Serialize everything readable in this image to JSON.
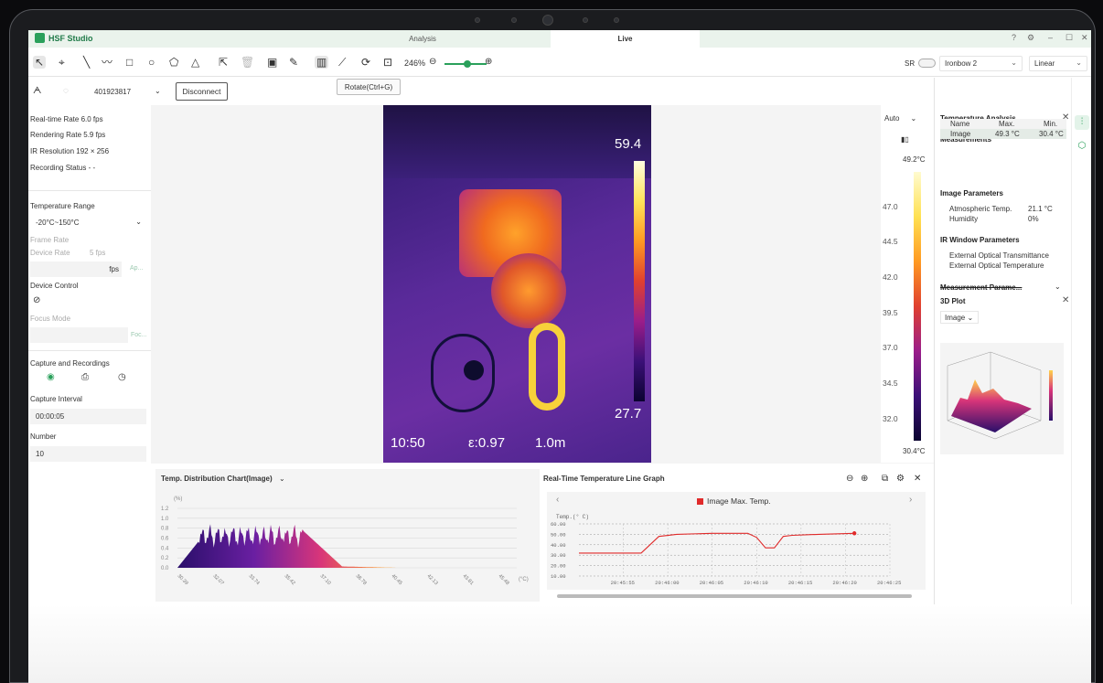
{
  "window": {
    "app_name": "HSF Studio",
    "tabs": [
      {
        "label": "Analysis"
      },
      {
        "label": "Live"
      }
    ],
    "controls": [
      "?",
      "⚙",
      "–",
      "☐",
      "✕"
    ]
  },
  "toolbar": {
    "zoom": "246%",
    "tooltip": "Rotate(Ctrl+G)",
    "sr_label": "SR",
    "palette": "Ironbow 2",
    "scale_mode": "Linear"
  },
  "device": {
    "id": "401923817",
    "disconnect_label": "Disconnect"
  },
  "status": {
    "realtime_rate": "Real-time Rate  6.0 fps",
    "rendering_rate": "Rendering Rate  5.9 fps",
    "ir_resolution": "IR Resolution  192 × 256",
    "recording_status": "Recording Status  - -"
  },
  "left_panel": {
    "temp_range_label": "Temperature Range",
    "temp_range_value": "-20°C~150°C",
    "frame_rate_label": "Frame Rate",
    "device_rate_label": "Device Rate",
    "device_rate_value": "5 fps",
    "fps_label": "fps",
    "apply_label": "Ap...",
    "device_control_label": "Device Control",
    "focus_mode_label": "Focus Mode",
    "focus_btn": "Foc...",
    "capture_label": "Capture and Recordings",
    "capture_interval_label": "Capture Interval",
    "capture_interval_value": "00:00:05",
    "number_label": "Number",
    "number_value": "10"
  },
  "image": {
    "max": "59.4",
    "min": "27.7",
    "time": "10:50",
    "emissivity": "ε:0.97",
    "distance": "1.0m"
  },
  "scale": {
    "mode": "Auto",
    "top": "49.2°C",
    "bottom": "30.4°C",
    "ticks": [
      "47.0",
      "44.5",
      "42.0",
      "39.5",
      "37.0",
      "34.5",
      "32.0"
    ]
  },
  "analysis": {
    "title": "Temperature Analysis",
    "measurements_title": "Measurements",
    "col_name": "Name",
    "col_max": "Max.",
    "col_min": "Min.",
    "row_name": "Image",
    "row_max": "49.3 °C",
    "row_min": "30.4 °C",
    "image_params_title": "Image Parameters",
    "atm_label": "Atmospheric Temp.",
    "atm_value": "21.1 °C",
    "hum_label": "Humidity",
    "hum_value": "0%",
    "ir_window_title": "IR Window Parameters",
    "ext_trans": "External Optical Transmittance",
    "ext_temp": "External Optical Temperature",
    "meas_params_title": "Measurement Parame...",
    "plot3d_title": "3D Plot",
    "plot3d_source": "Image"
  },
  "histogram": {
    "title": "Temp. Distribution Chart(Image)",
    "y_unit": "(%)",
    "y_ticks": [
      "1.2",
      "1.0",
      "0.8",
      "0.6",
      "0.4",
      "0.2",
      "0.0"
    ],
    "x_ticks": [
      "30.39",
      "32.07",
      "33.74",
      "35.42",
      "37.10",
      "38.78",
      "40.45",
      "42.13",
      "43.81",
      "45.48"
    ],
    "x_unit": "(°C)"
  },
  "chart_data": {
    "type": "line",
    "title": "Real-Time Temperature Line Graph",
    "ylabel": "Temp.(° C)",
    "ylim": [
      10,
      60
    ],
    "y_ticks": [
      "60.00",
      "50.00",
      "40.00",
      "30.00",
      "20.00",
      "10.00"
    ],
    "x_ticks": [
      "20:45:55",
      "20:46:00",
      "20:46:05",
      "20:46:10",
      "20:46:15",
      "20:46:20",
      "20:46:25"
    ],
    "series": [
      {
        "name": "Image Max. Temp.",
        "color": "#e02a2a",
        "x": [
          "20:45:50",
          "20:45:56",
          "20:45:57",
          "20:45:59",
          "20:46:01",
          "20:46:05",
          "20:46:09",
          "20:46:10",
          "20:46:11",
          "20:46:12",
          "20:46:13",
          "20:46:14",
          "20:46:17",
          "20:46:21"
        ],
        "values": [
          32,
          32,
          32,
          48,
          50,
          51,
          51,
          47,
          37,
          37,
          48,
          49,
          50,
          51
        ]
      }
    ]
  }
}
